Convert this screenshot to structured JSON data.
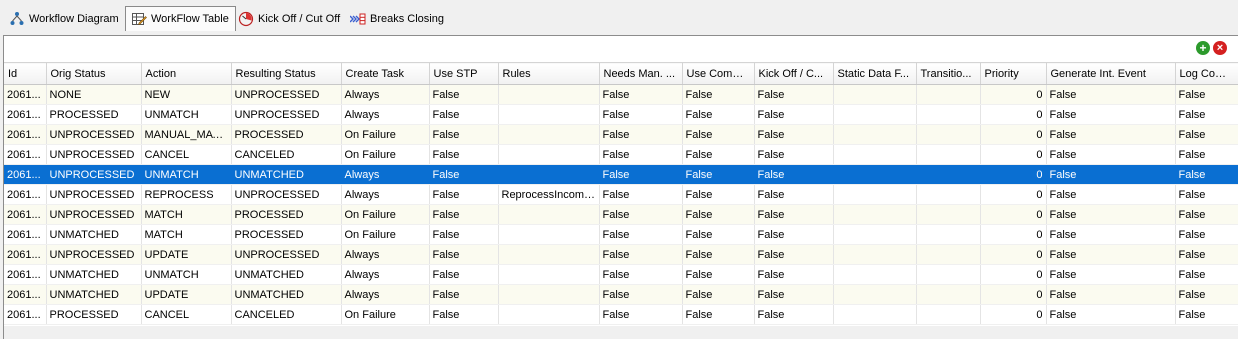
{
  "tabs": [
    {
      "label": "Workflow Diagram",
      "icon": "workflow-diagram-icon"
    },
    {
      "label": "WorkFlow Table",
      "icon": "workflow-table-icon"
    },
    {
      "label": "Kick Off / Cut Off",
      "icon": "kickoff-cutoff-icon"
    },
    {
      "label": "Breaks Closing",
      "icon": "breaks-closing-icon"
    }
  ],
  "selected_tab": "WorkFlow Table",
  "toolbar": {
    "add_icon": "add-icon",
    "delete_icon": "delete-icon"
  },
  "table": {
    "columns": [
      "Id",
      "Orig Status",
      "Action",
      "Resulting Status",
      "Create Task",
      "Use STP",
      "Rules",
      "Needs Man. ...",
      "Use Comm...",
      "Kick Off / C...",
      "Static Data F...",
      "Transitio...",
      "Priority",
      "Generate Int. Event",
      "Log Comple"
    ],
    "selected_row": 4,
    "rows": [
      [
        "2061...",
        "NONE",
        "NEW",
        "UNPROCESSED",
        "Always",
        "False",
        "",
        "False",
        "False",
        "False",
        "",
        "",
        "0",
        "False",
        "False"
      ],
      [
        "2061...",
        "PROCESSED",
        "UNMATCH",
        "UNPROCESSED",
        "Always",
        "False",
        "",
        "False",
        "False",
        "False",
        "",
        "",
        "0",
        "False",
        "False"
      ],
      [
        "2061...",
        "UNPROCESSED",
        "MANUAL_MATCH",
        "PROCESSED",
        "On Failure",
        "False",
        "",
        "False",
        "False",
        "False",
        "",
        "",
        "0",
        "False",
        "False"
      ],
      [
        "2061...",
        "UNPROCESSED",
        "CANCEL",
        "CANCELED",
        "On Failure",
        "False",
        "",
        "False",
        "False",
        "False",
        "",
        "",
        "0",
        "False",
        "False"
      ],
      [
        "2061...",
        "UNPROCESSED",
        "UNMATCH",
        "UNMATCHED",
        "Always",
        "False",
        "",
        "False",
        "False",
        "False",
        "",
        "",
        "0",
        "False",
        "False"
      ],
      [
        "2061...",
        "UNPROCESSED",
        "REPROCESS",
        "UNPROCESSED",
        "Always",
        "False",
        "ReprocessIncoming",
        "False",
        "False",
        "False",
        "",
        "",
        "0",
        "False",
        "False"
      ],
      [
        "2061...",
        "UNPROCESSED",
        "MATCH",
        "PROCESSED",
        "On Failure",
        "False",
        "",
        "False",
        "False",
        "False",
        "",
        "",
        "0",
        "False",
        "False"
      ],
      [
        "2061...",
        "UNMATCHED",
        "MATCH",
        "PROCESSED",
        "On Failure",
        "False",
        "",
        "False",
        "False",
        "False",
        "",
        "",
        "0",
        "False",
        "False"
      ],
      [
        "2061...",
        "UNPROCESSED",
        "UPDATE",
        "UNPROCESSED",
        "Always",
        "False",
        "",
        "False",
        "False",
        "False",
        "",
        "",
        "0",
        "False",
        "False"
      ],
      [
        "2061...",
        "UNMATCHED",
        "UNMATCH",
        "UNMATCHED",
        "Always",
        "False",
        "",
        "False",
        "False",
        "False",
        "",
        "",
        "0",
        "False",
        "False"
      ],
      [
        "2061...",
        "UNMATCHED",
        "UPDATE",
        "UNMATCHED",
        "Always",
        "False",
        "",
        "False",
        "False",
        "False",
        "",
        "",
        "0",
        "False",
        "False"
      ],
      [
        "2061...",
        "PROCESSED",
        "CANCEL",
        "CANCELED",
        "On Failure",
        "False",
        "",
        "False",
        "False",
        "False",
        "",
        "",
        "0",
        "False",
        "False"
      ]
    ]
  }
}
